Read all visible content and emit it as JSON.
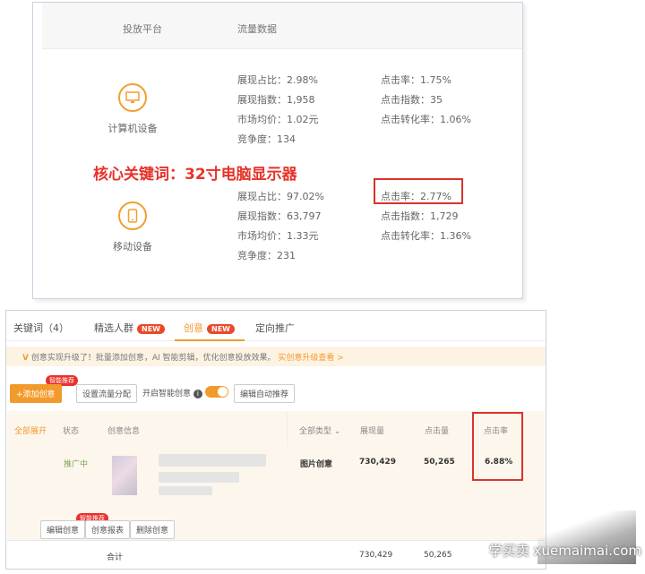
{
  "top": {
    "header": {
      "platform": "投放平台",
      "traffic": "流量数据"
    },
    "keyword": "核心关键词：32寸电脑显示器",
    "devices": [
      {
        "name": "计算机设备",
        "icon": "monitor-icon",
        "left": [
          {
            "label": "展现占比：",
            "value": "2.98%"
          },
          {
            "label": "展现指数：",
            "value": "1,958"
          },
          {
            "label": "市场均价：",
            "value": "1.02元"
          },
          {
            "label": "竞争度：",
            "value": "134"
          }
        ],
        "right": [
          {
            "label": "点击率：",
            "value": "1.75%"
          },
          {
            "label": "点击指数：",
            "value": "35"
          },
          {
            "label": "点击转化率：",
            "value": "1.06%"
          }
        ]
      },
      {
        "name": "移动设备",
        "icon": "phone-icon",
        "left": [
          {
            "label": "展现占比：",
            "value": "97.02%"
          },
          {
            "label": "展现指数：",
            "value": "63,797"
          },
          {
            "label": "市场均价：",
            "value": "1.33元"
          },
          {
            "label": "竞争度：",
            "value": "231"
          }
        ],
        "right": [
          {
            "label": "点击率：",
            "value": "2.77%"
          },
          {
            "label": "点击指数：",
            "value": "1,729"
          },
          {
            "label": "点击转化率：",
            "value": "1.36%"
          }
        ]
      }
    ]
  },
  "bottom": {
    "tabs": [
      {
        "label": "关键词（4）"
      },
      {
        "label": "精选人群",
        "badge": "NEW"
      },
      {
        "label": "创意",
        "badge": "NEW"
      },
      {
        "label": "定向推广"
      }
    ],
    "notice": {
      "v": "V",
      "text": "创意实现升级了！批量添加创意，AI 智能剪辑，优化创意投放效果。",
      "link": "实创意升级查看 >"
    },
    "toolbar": {
      "add": "+添加创意",
      "add_badge": "智能推荐",
      "traffic": "设置流量分配",
      "smart_label": "开启智能创意",
      "report": "编辑自动推荐"
    },
    "headers": {
      "all": "全部展开",
      "status": "状态",
      "info": "创意信息",
      "type": "全部类型",
      "impr": "展现量",
      "clicks": "点击量",
      "ctr": "点击率"
    },
    "row": {
      "status": "推广中",
      "type": "图片创意",
      "impr": "730,429",
      "clicks": "50,265",
      "ctr": "6.88%"
    },
    "row_actions": {
      "edit": "编辑创意",
      "edit_badge": "智能推荐",
      "report": "创意报表",
      "delete": "删除创意"
    },
    "total": {
      "label": "合计",
      "impr": "730,429",
      "clicks": "50,265"
    }
  },
  "watermark": "学买卖 xuemaimai.com",
  "colors": {
    "accent": "#f39a2c",
    "highlight_red": "#d9342b",
    "keyword_red": "#e8322a"
  }
}
